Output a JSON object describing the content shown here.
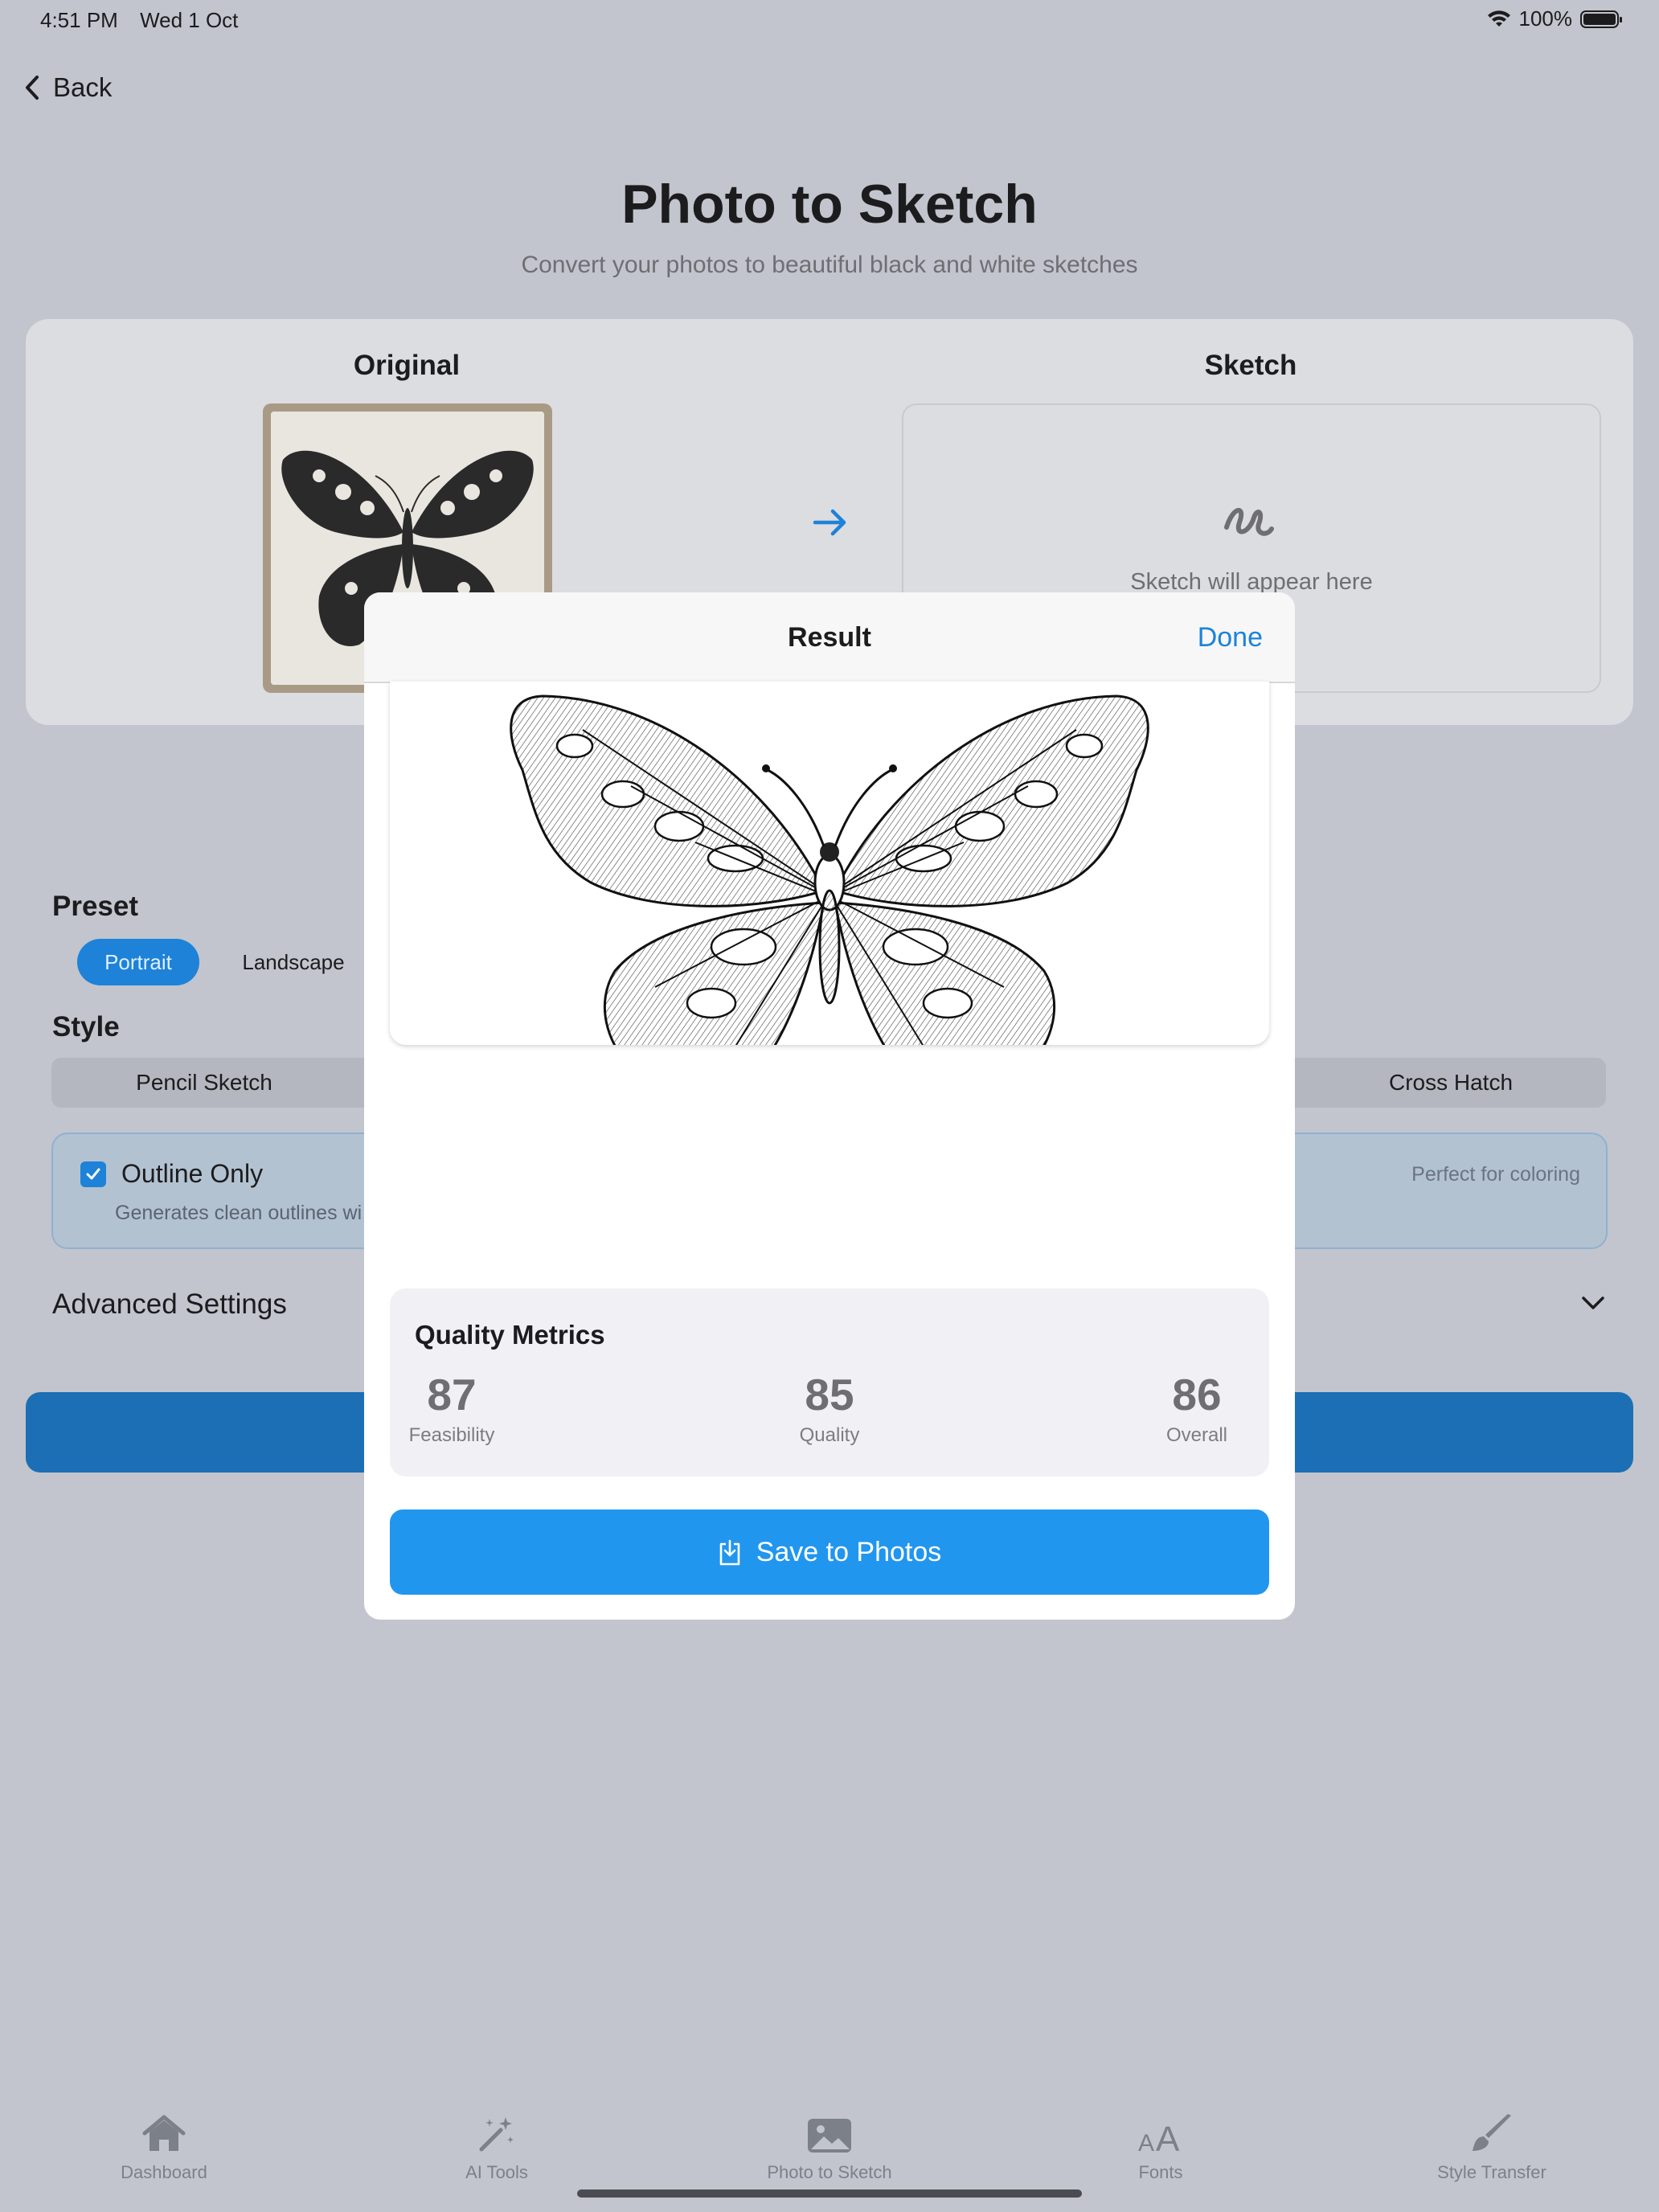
{
  "status_bar": {
    "time": "4:51 PM",
    "date": "Wed 1 Oct",
    "battery": "100%"
  },
  "nav": {
    "back_label": "Back"
  },
  "header": {
    "title": "Photo to Sketch",
    "subtitle": "Convert your photos to beautiful black and white sketches"
  },
  "compare": {
    "original_label": "Original",
    "sketch_label": "Sketch",
    "sketch_placeholder": "Sketch will appear here"
  },
  "preset": {
    "heading": "Preset",
    "options": [
      "Portrait",
      "Landscape"
    ],
    "selected": "Portrait"
  },
  "style": {
    "heading": "Style",
    "options_visible": [
      "Pencil Sketch",
      "Cross Hatch"
    ]
  },
  "outline": {
    "title": "Outline Only",
    "description": "Generates clean outlines wi",
    "note": "Perfect for coloring",
    "checked": true
  },
  "advanced": {
    "label": "Advanced Settings"
  },
  "modal": {
    "title": "Result",
    "done_label": "Done",
    "metrics_title": "Quality Metrics",
    "metrics": [
      {
        "value": "87",
        "label": "Feasibility"
      },
      {
        "value": "85",
        "label": "Quality"
      },
      {
        "value": "86",
        "label": "Overall"
      }
    ],
    "save_label": "Save to Photos"
  },
  "tabs": [
    {
      "label": "Dashboard",
      "icon": "house-icon"
    },
    {
      "label": "AI Tools",
      "icon": "wand-sparkles-icon"
    },
    {
      "label": "Photo to Sketch",
      "icon": "photo-icon"
    },
    {
      "label": "Fonts",
      "icon": "text-size-icon"
    },
    {
      "label": "Style Transfer",
      "icon": "paintbrush-icon"
    }
  ],
  "colors": {
    "accent": "#2196ef",
    "selected_chip": "#1d82d8",
    "backdrop": "#c2c5cd"
  }
}
